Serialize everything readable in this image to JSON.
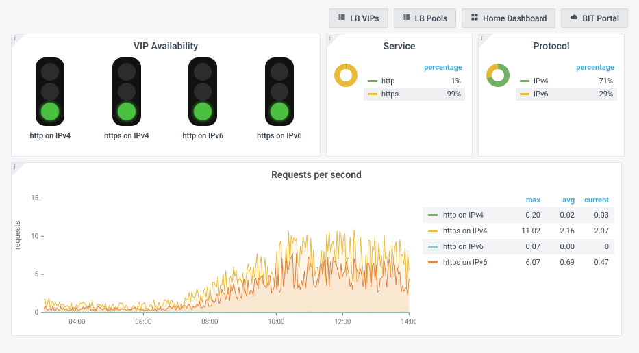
{
  "colors": {
    "green": "#72b065",
    "yellow": "#e9b93b",
    "cyan": "#7ec9c9",
    "orange": "#e67f3d"
  },
  "nav": [
    {
      "icon": "list",
      "label": "LB VIPs"
    },
    {
      "icon": "list",
      "label": "LB Pools"
    },
    {
      "icon": "grid",
      "label": "Home Dashboard"
    },
    {
      "icon": "cloud",
      "label": "BIT Portal"
    }
  ],
  "vip": {
    "title": "VIP Availability",
    "items": [
      {
        "label": "http on IPv4",
        "state": "green"
      },
      {
        "label": "https on IPv4",
        "state": "green"
      },
      {
        "label": "http on IPv6",
        "state": "green"
      },
      {
        "label": "https on IPv6",
        "state": "green"
      }
    ]
  },
  "service": {
    "title": "Service",
    "header": "percentage",
    "color_a": "#72b065",
    "color_b": "#e9b93b",
    "rows": [
      {
        "name": "http",
        "value": "1%",
        "color": "#72b065",
        "selected": false
      },
      {
        "name": "https",
        "value": "99%",
        "color": "#e9b93b",
        "selected": true
      }
    ],
    "pie_fraction_a": 0.01
  },
  "protocol": {
    "title": "Protocol",
    "header": "percentage",
    "color_a": "#72b065",
    "color_b": "#e9b93b",
    "rows": [
      {
        "name": "IPv4",
        "value": "71%",
        "color": "#72b065",
        "selected": false
      },
      {
        "name": "IPv6",
        "value": "29%",
        "color": "#e9b93b",
        "selected": true
      }
    ],
    "pie_fraction_a": 0.71
  },
  "rps": {
    "title": "Requests per second",
    "ylabel": "requests",
    "table_headers": [
      "max",
      "avg",
      "current"
    ],
    "series": [
      {
        "name": "http on IPv4",
        "color": "#72b065",
        "max": "0.20",
        "avg": "0.02",
        "current": "0.03"
      },
      {
        "name": "https on IPv4",
        "color": "#e9b93b",
        "max": "11.02",
        "avg": "2.16",
        "current": "2.07"
      },
      {
        "name": "http on IPv6",
        "color": "#7ec9c9",
        "max": "0.07",
        "avg": "0.00",
        "current": "0"
      },
      {
        "name": "https on IPv6",
        "color": "#e67f3d",
        "max": "6.07",
        "avg": "0.69",
        "current": "0.47"
      }
    ]
  },
  "chart_data": {
    "type": "line",
    "title": "Requests per second",
    "ylabel": "requests",
    "xlabel": "",
    "ylim": [
      0,
      16
    ],
    "y_ticks": [
      0,
      5,
      10,
      15
    ],
    "x_ticks": [
      "04:00",
      "06:00",
      "08:00",
      "10:00",
      "12:00",
      "14:00"
    ],
    "x": [
      "03:00",
      "03:30",
      "04:00",
      "04:30",
      "05:00",
      "05:30",
      "06:00",
      "06:30",
      "07:00",
      "07:30",
      "08:00",
      "08:30",
      "09:00",
      "09:30",
      "10:00",
      "10:30",
      "11:00",
      "11:30",
      "12:00",
      "12:30",
      "13:00",
      "13:30",
      "14:00"
    ],
    "series": [
      {
        "name": "http on IPv4",
        "color": "#72b065",
        "values": [
          0.02,
          0.01,
          0.02,
          0.01,
          0.02,
          0.02,
          0.02,
          0.01,
          0.02,
          0.02,
          0.02,
          0.02,
          0.02,
          0.02,
          0.02,
          0.02,
          0.02,
          0.02,
          0.02,
          0.02,
          0.02,
          0.02,
          0.03
        ]
      },
      {
        "name": "https on IPv4",
        "color": "#e9b93b",
        "values": [
          1.5,
          1.0,
          0.8,
          1.0,
          0.7,
          0.8,
          0.8,
          1.2,
          1.0,
          2.0,
          2.5,
          4.0,
          4.5,
          5.5,
          6.5,
          7.5,
          7.0,
          7.5,
          8.5,
          7.0,
          7.5,
          7.0,
          6.0
        ]
      },
      {
        "name": "http on IPv6",
        "color": "#7ec9c9",
        "values": [
          0.0,
          0.0,
          0.0,
          0.0,
          0.0,
          0.0,
          0.0,
          0.0,
          0.0,
          0.0,
          0.0,
          0.0,
          0.0,
          0.0,
          0.0,
          0.0,
          0.0,
          0.0,
          0.0,
          0.0,
          0.0,
          0.0,
          0.0
        ]
      },
      {
        "name": "https on IPv6",
        "color": "#e67f3d",
        "values": [
          0.6,
          0.5,
          0.4,
          0.5,
          0.4,
          0.4,
          0.4,
          0.5,
          0.5,
          0.8,
          1.2,
          2.5,
          3.0,
          3.5,
          4.5,
          5.5,
          5.0,
          5.0,
          6.0,
          4.5,
          4.5,
          5.0,
          4.0
        ]
      }
    ]
  }
}
